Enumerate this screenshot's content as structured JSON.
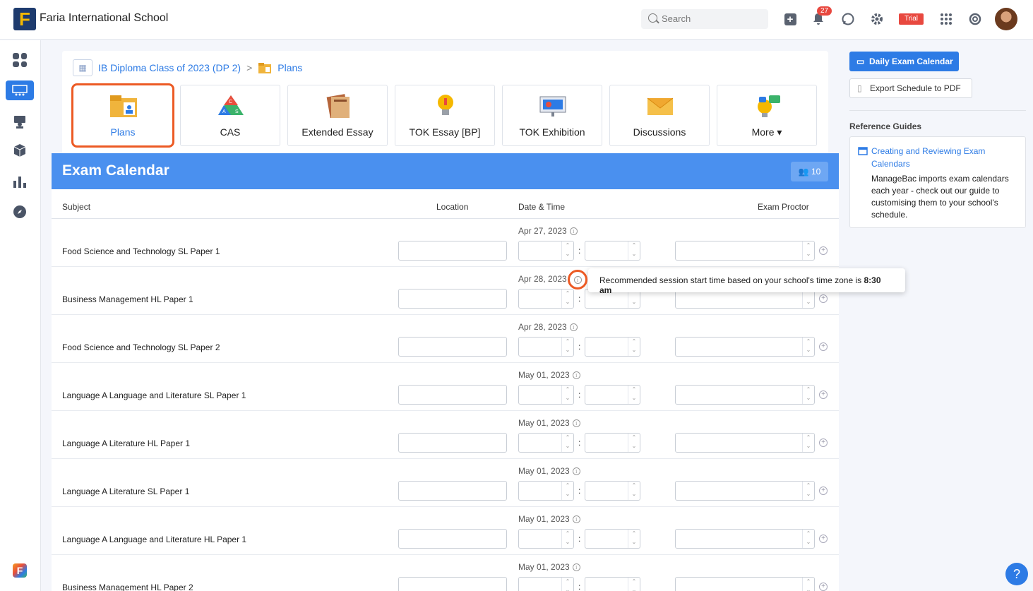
{
  "header": {
    "logo_letter": "F",
    "school_name": "Faria International School",
    "search_placeholder": "Search",
    "notifications_count": "27",
    "trial_label": "Trial"
  },
  "breadcrumb": {
    "class_name": "IB Diploma Class of 2023 (DP 2)",
    "separator": ">",
    "current": "Plans"
  },
  "tiles": [
    {
      "label": "Plans"
    },
    {
      "label": "CAS"
    },
    {
      "label": "Extended Essay"
    },
    {
      "label": "TOK Essay [BP]"
    },
    {
      "label": "TOK Exhibition"
    },
    {
      "label": "Discussions"
    },
    {
      "label": "More ▾"
    }
  ],
  "exam": {
    "title": "Exam Calendar",
    "count": "10",
    "columns": {
      "subject": "Subject",
      "location": "Location",
      "datetime": "Date & Time",
      "proctor": "Exam Proctor"
    },
    "rows": [
      {
        "subject": "Food Science and Technology SL Paper 1",
        "date": "Apr 27, 2023"
      },
      {
        "subject": "Business Management HL Paper 1",
        "date": "Apr 28, 2023"
      },
      {
        "subject": "Food Science and Technology SL Paper 2",
        "date": "Apr 28, 2023"
      },
      {
        "subject": "Language A Language and Literature SL Paper 1",
        "date": "May 01, 2023"
      },
      {
        "subject": "Language A Literature HL Paper 1",
        "date": "May 01, 2023"
      },
      {
        "subject": "Language A Literature SL Paper 1",
        "date": "May 01, 2023"
      },
      {
        "subject": "Language A Language and Literature HL Paper 1",
        "date": "May 01, 2023"
      },
      {
        "subject": "Business Management HL Paper 2",
        "date": "May 01, 2023"
      }
    ],
    "colon": ":",
    "tooltip": {
      "text": "Recommended session start time based on your school's time zone is ",
      "time": "8:30 am"
    }
  },
  "right_panel": {
    "daily_button": "Daily Exam Calendar",
    "export_button": "Export Schedule to PDF",
    "guides_heading": "Reference Guides",
    "guide_link": "Creating and Reviewing Exam Calendars",
    "guide_desc": "ManageBac imports exam calendars each year - check out our guide to customising them to your school's schedule."
  },
  "colors": {
    "accent": "#2d7be5",
    "header_blue": "#4a90ef",
    "highlight": "#ec5a24",
    "badge_red": "#e8483f"
  }
}
